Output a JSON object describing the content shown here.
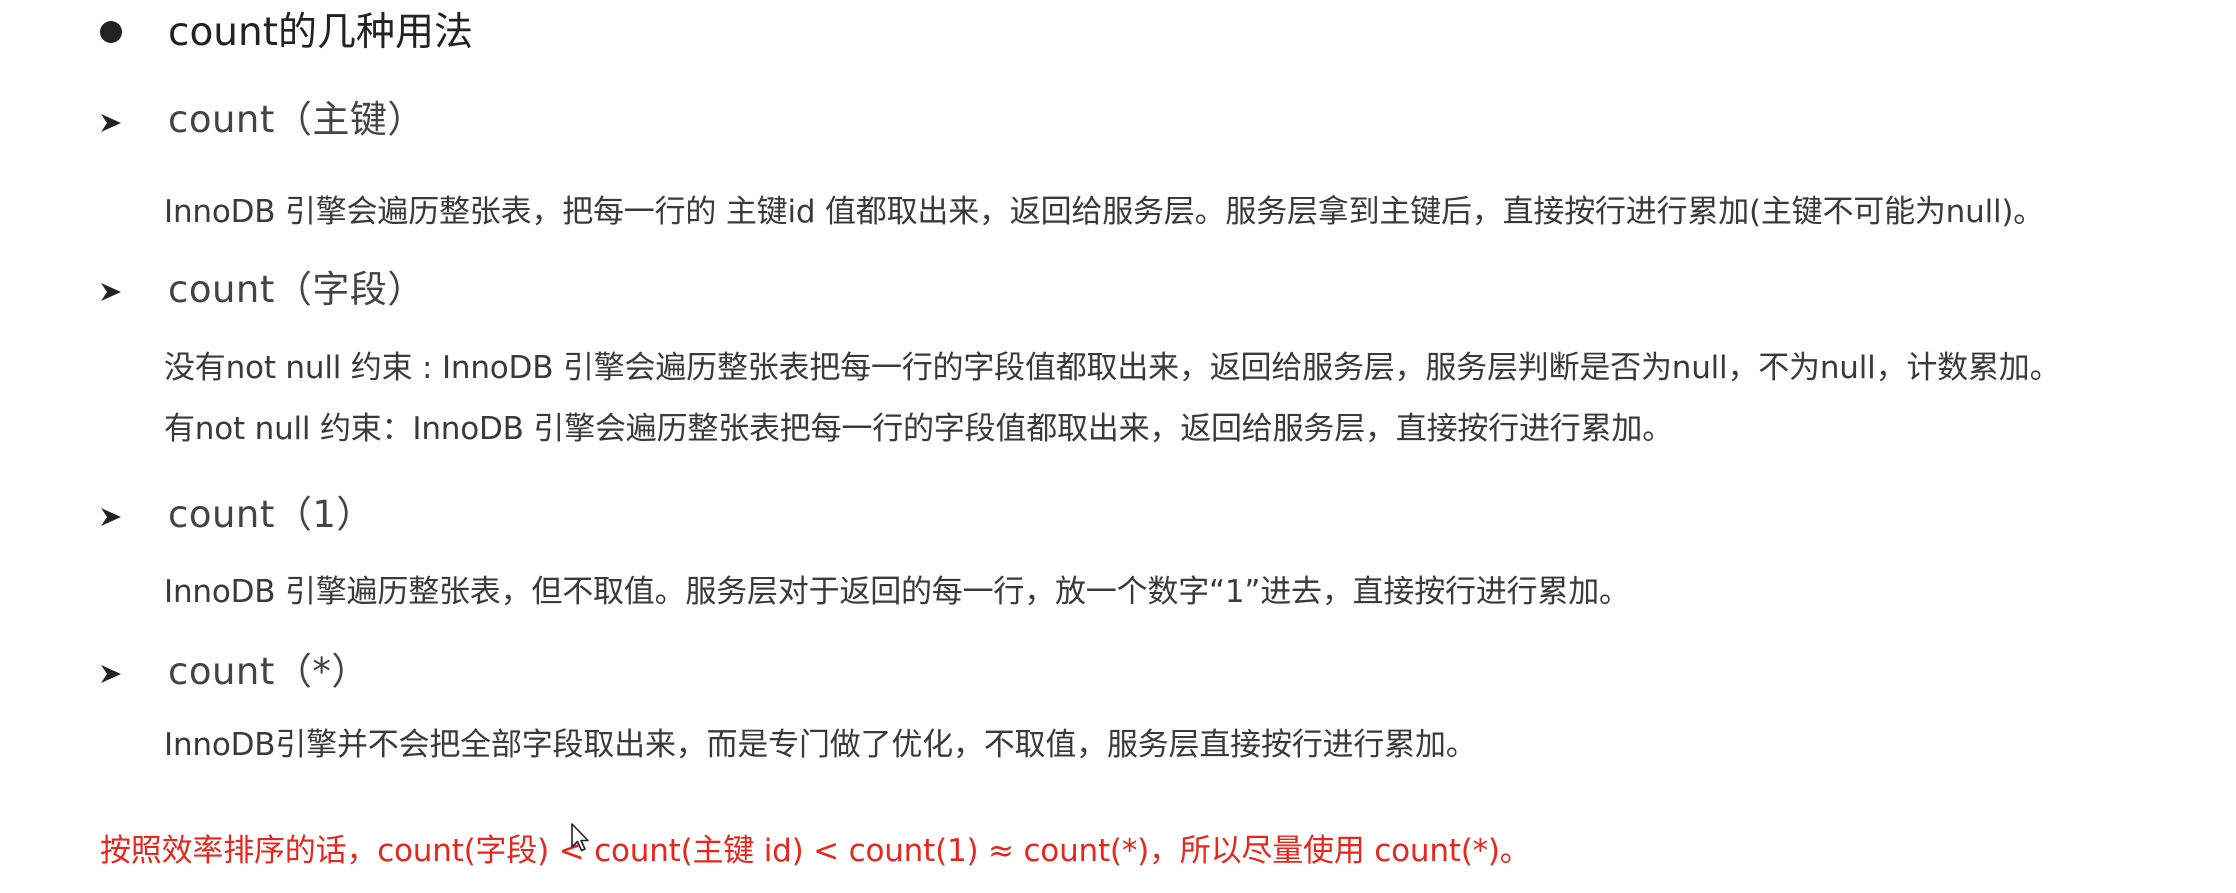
{
  "heading": "count的几种用法",
  "sections": [
    {
      "title": "count（主键）",
      "lines": [
        "InnoDB 引擎会遍历整张表，把每一行的 主键id 值都取出来，返回给服务层。服务层拿到主键后，直接按行进行累加(主键不可能为null)。"
      ]
    },
    {
      "title": "count（字段）",
      "lines": [
        "没有not null 约束 : InnoDB 引擎会遍历整张表把每一行的字段值都取出来，返回给服务层，服务层判断是否为null，不为null，计数累加。",
        "有not null 约束：InnoDB 引擎会遍历整张表把每一行的字段值都取出来，返回给服务层，直接按行进行累加。"
      ]
    },
    {
      "title": "count（1）",
      "lines": [
        "InnoDB 引擎遍历整张表，但不取值。服务层对于返回的每一行，放一个数字“1”进去，直接按行进行累加。"
      ]
    },
    {
      "title": "count（*）",
      "lines": [
        "InnoDB引擎并不会把全部字段取出来，而是专门做了优化，不取值，服务层直接按行进行累加。"
      ]
    }
  ],
  "conclusion": "按照效率排序的话，count(字段) < count(主键 id) < count(1) ≈ count(*)，所以尽量使用 count(*)。",
  "colors": {
    "heading": "#222222",
    "body_text": "#3a3a3a",
    "conclusion": "#e8261d"
  },
  "icons": {
    "heading_bullet": "filled-circle",
    "section_bullet": "arrowhead-right",
    "cursor": "mouse-pointer-arrow"
  }
}
